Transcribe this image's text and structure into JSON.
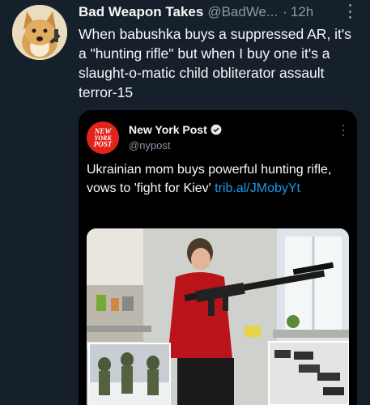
{
  "tweet": {
    "display_name": "Bad Weapon Takes",
    "handle": "@BadWe...",
    "separator": "·",
    "time": "12h",
    "text": "When babushka buys a suppressed AR, it's a \"hunting rifle\" but when I buy one it's a slaught-o-matic child obliterator assault terror-15",
    "avatar_icon": "doge-avatar"
  },
  "quote": {
    "logo_text": [
      "NEW",
      "YORK",
      "POST"
    ],
    "name": "New York Post",
    "handle": "@nypost",
    "text": "Ukrainian mom buys powerful hunting rifle, vows to 'fight for Kiev' ",
    "link": "trib.al/JMobyYt",
    "verified_icon": "verified-badge-icon",
    "brand_color": "#e2231a",
    "link_color": "#1d9bf0"
  }
}
